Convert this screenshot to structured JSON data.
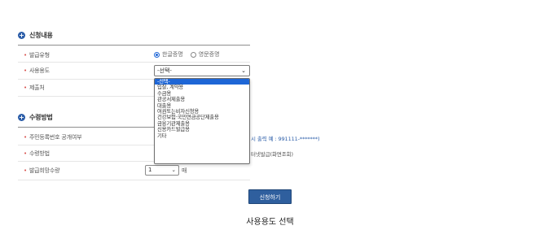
{
  "section1": {
    "title": "신청내용",
    "fields": [
      {
        "label": "발급유형"
      },
      {
        "label": "사용용도"
      },
      {
        "label": "제출처"
      }
    ],
    "issue_type_options": [
      "한글증명",
      "영문증명"
    ],
    "issue_type_selected": "한글증명",
    "usage_select_value": "-선택-",
    "usage_options": [
      "-선택-",
      "입찰, 계약용",
      "수금용",
      "관공서제출용",
      "대출용",
      "여권또는비자신청용",
      "건강보험·국민연금공단제출용",
      "금융기관제출용",
      "신용카드발급용",
      "기타"
    ],
    "usage_highlighted_index": 0
  },
  "section2": {
    "title": "수령방법",
    "fields": [
      {
        "label": "주민등록번호 공개여부"
      },
      {
        "label": "수령방법"
      },
      {
        "label": "발급희망수량"
      }
    ],
    "hint": "시 출력 예 : 991111-*******)",
    "delivery_text": "터넷발급(화면조회)",
    "quantity_value": "1",
    "quantity_unit": "매"
  },
  "submit_label": "신청하기",
  "caption": "사용용도 선택",
  "colors": {
    "accent": "#2b5da8",
    "selected": "#1e66d6",
    "button": "#2f5f9e",
    "required": "#d9534f"
  }
}
